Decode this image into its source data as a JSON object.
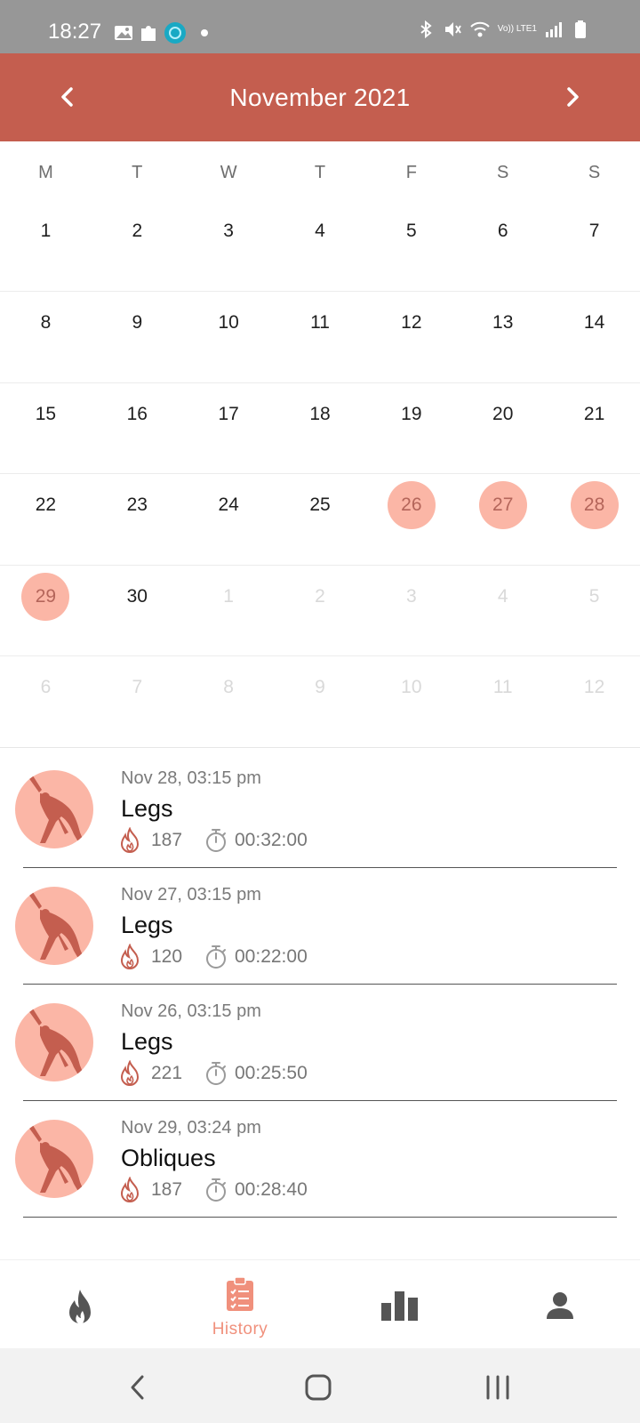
{
  "status_bar": {
    "time": "18:27",
    "network_label": "Vo)) LTE1",
    "icons": [
      "image-icon",
      "puzzle-icon",
      "app-badge-icon",
      "dot-icon",
      "bluetooth-icon",
      "mute-icon",
      "wifi-icon",
      "signal-icon",
      "battery-icon"
    ]
  },
  "header": {
    "title": "November  2021",
    "prev_icon": "chevron-left-icon",
    "next_icon": "chevron-right-icon",
    "background": "#c45e4f"
  },
  "calendar": {
    "weekdays": [
      "M",
      "T",
      "W",
      "T",
      "F",
      "S",
      "S"
    ],
    "weeks": [
      [
        {
          "d": "1"
        },
        {
          "d": "2"
        },
        {
          "d": "3"
        },
        {
          "d": "4"
        },
        {
          "d": "5"
        },
        {
          "d": "6"
        },
        {
          "d": "7"
        }
      ],
      [
        {
          "d": "8"
        },
        {
          "d": "9"
        },
        {
          "d": "10"
        },
        {
          "d": "11"
        },
        {
          "d": "12"
        },
        {
          "d": "13"
        },
        {
          "d": "14"
        }
      ],
      [
        {
          "d": "15"
        },
        {
          "d": "16"
        },
        {
          "d": "17"
        },
        {
          "d": "18"
        },
        {
          "d": "19"
        },
        {
          "d": "20"
        },
        {
          "d": "21"
        }
      ],
      [
        {
          "d": "22"
        },
        {
          "d": "23"
        },
        {
          "d": "24"
        },
        {
          "d": "25"
        },
        {
          "d": "26",
          "marked": true
        },
        {
          "d": "27",
          "marked": true
        },
        {
          "d": "28",
          "marked": true
        }
      ],
      [
        {
          "d": "29",
          "marked": true
        },
        {
          "d": "30"
        },
        {
          "d": "1",
          "other": true
        },
        {
          "d": "2",
          "other": true
        },
        {
          "d": "3",
          "other": true
        },
        {
          "d": "4",
          "other": true
        },
        {
          "d": "5",
          "other": true
        }
      ],
      [
        {
          "d": "6",
          "other": true
        },
        {
          "d": "7",
          "other": true
        },
        {
          "d": "8",
          "other": true
        },
        {
          "d": "9",
          "other": true
        },
        {
          "d": "10",
          "other": true
        },
        {
          "d": "11",
          "other": true
        },
        {
          "d": "12",
          "other": true
        }
      ]
    ],
    "marked_color": "#fbb6a6"
  },
  "history": [
    {
      "date": "Nov 28, 03:15 pm",
      "title": "Legs",
      "kcal": "187",
      "duration": "00:32:00"
    },
    {
      "date": "Nov 27, 03:15 pm",
      "title": "Legs",
      "kcal": "120",
      "duration": "00:22:00"
    },
    {
      "date": "Nov 26, 03:15 pm",
      "title": "Legs",
      "kcal": "221",
      "duration": "00:25:50"
    },
    {
      "date": "Nov 29, 03:24 pm",
      "title": "Obliques",
      "kcal": "187",
      "duration": "00:28:40"
    }
  ],
  "bottom_nav": {
    "tabs": [
      {
        "icon": "flame-icon",
        "label": ""
      },
      {
        "icon": "clipboard-icon",
        "label": "History",
        "active": true
      },
      {
        "icon": "bar-chart-icon",
        "label": ""
      },
      {
        "icon": "person-icon",
        "label": ""
      }
    ],
    "active_color": "#f0907c"
  },
  "system_nav": {
    "buttons": [
      "back-icon",
      "home-icon",
      "recents-icon"
    ]
  }
}
